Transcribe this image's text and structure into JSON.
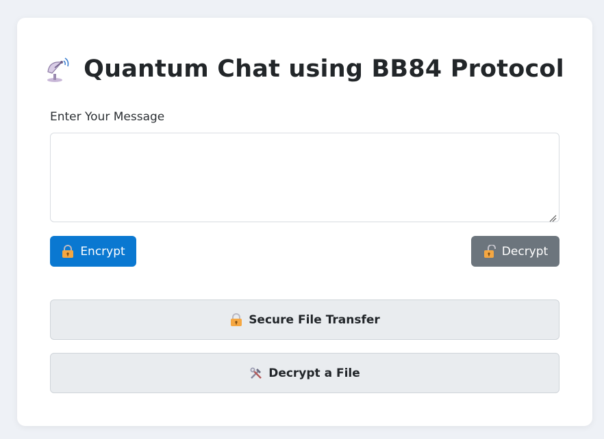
{
  "header": {
    "title": "Quantum Chat using BB84 Protocol",
    "icon": "satellite-antenna-icon"
  },
  "message": {
    "label": "Enter Your Message",
    "value": "",
    "placeholder": ""
  },
  "actions": {
    "encrypt_label": "Encrypt",
    "encrypt_icon": "locked-with-key-icon",
    "decrypt_label": "Decrypt",
    "decrypt_icon": "unlocked-icon",
    "secure_transfer_label": "Secure File Transfer",
    "secure_transfer_icon": "locked-with-key-icon",
    "decrypt_file_label": "Decrypt a File",
    "decrypt_file_icon": "hammer-and-wrench-icon"
  },
  "colors": {
    "page_bg": "#eef1f6",
    "encrypt_bg": "#0a78d1",
    "decrypt_bg": "#6c757d",
    "secondary_bg": "#e9ecef"
  }
}
